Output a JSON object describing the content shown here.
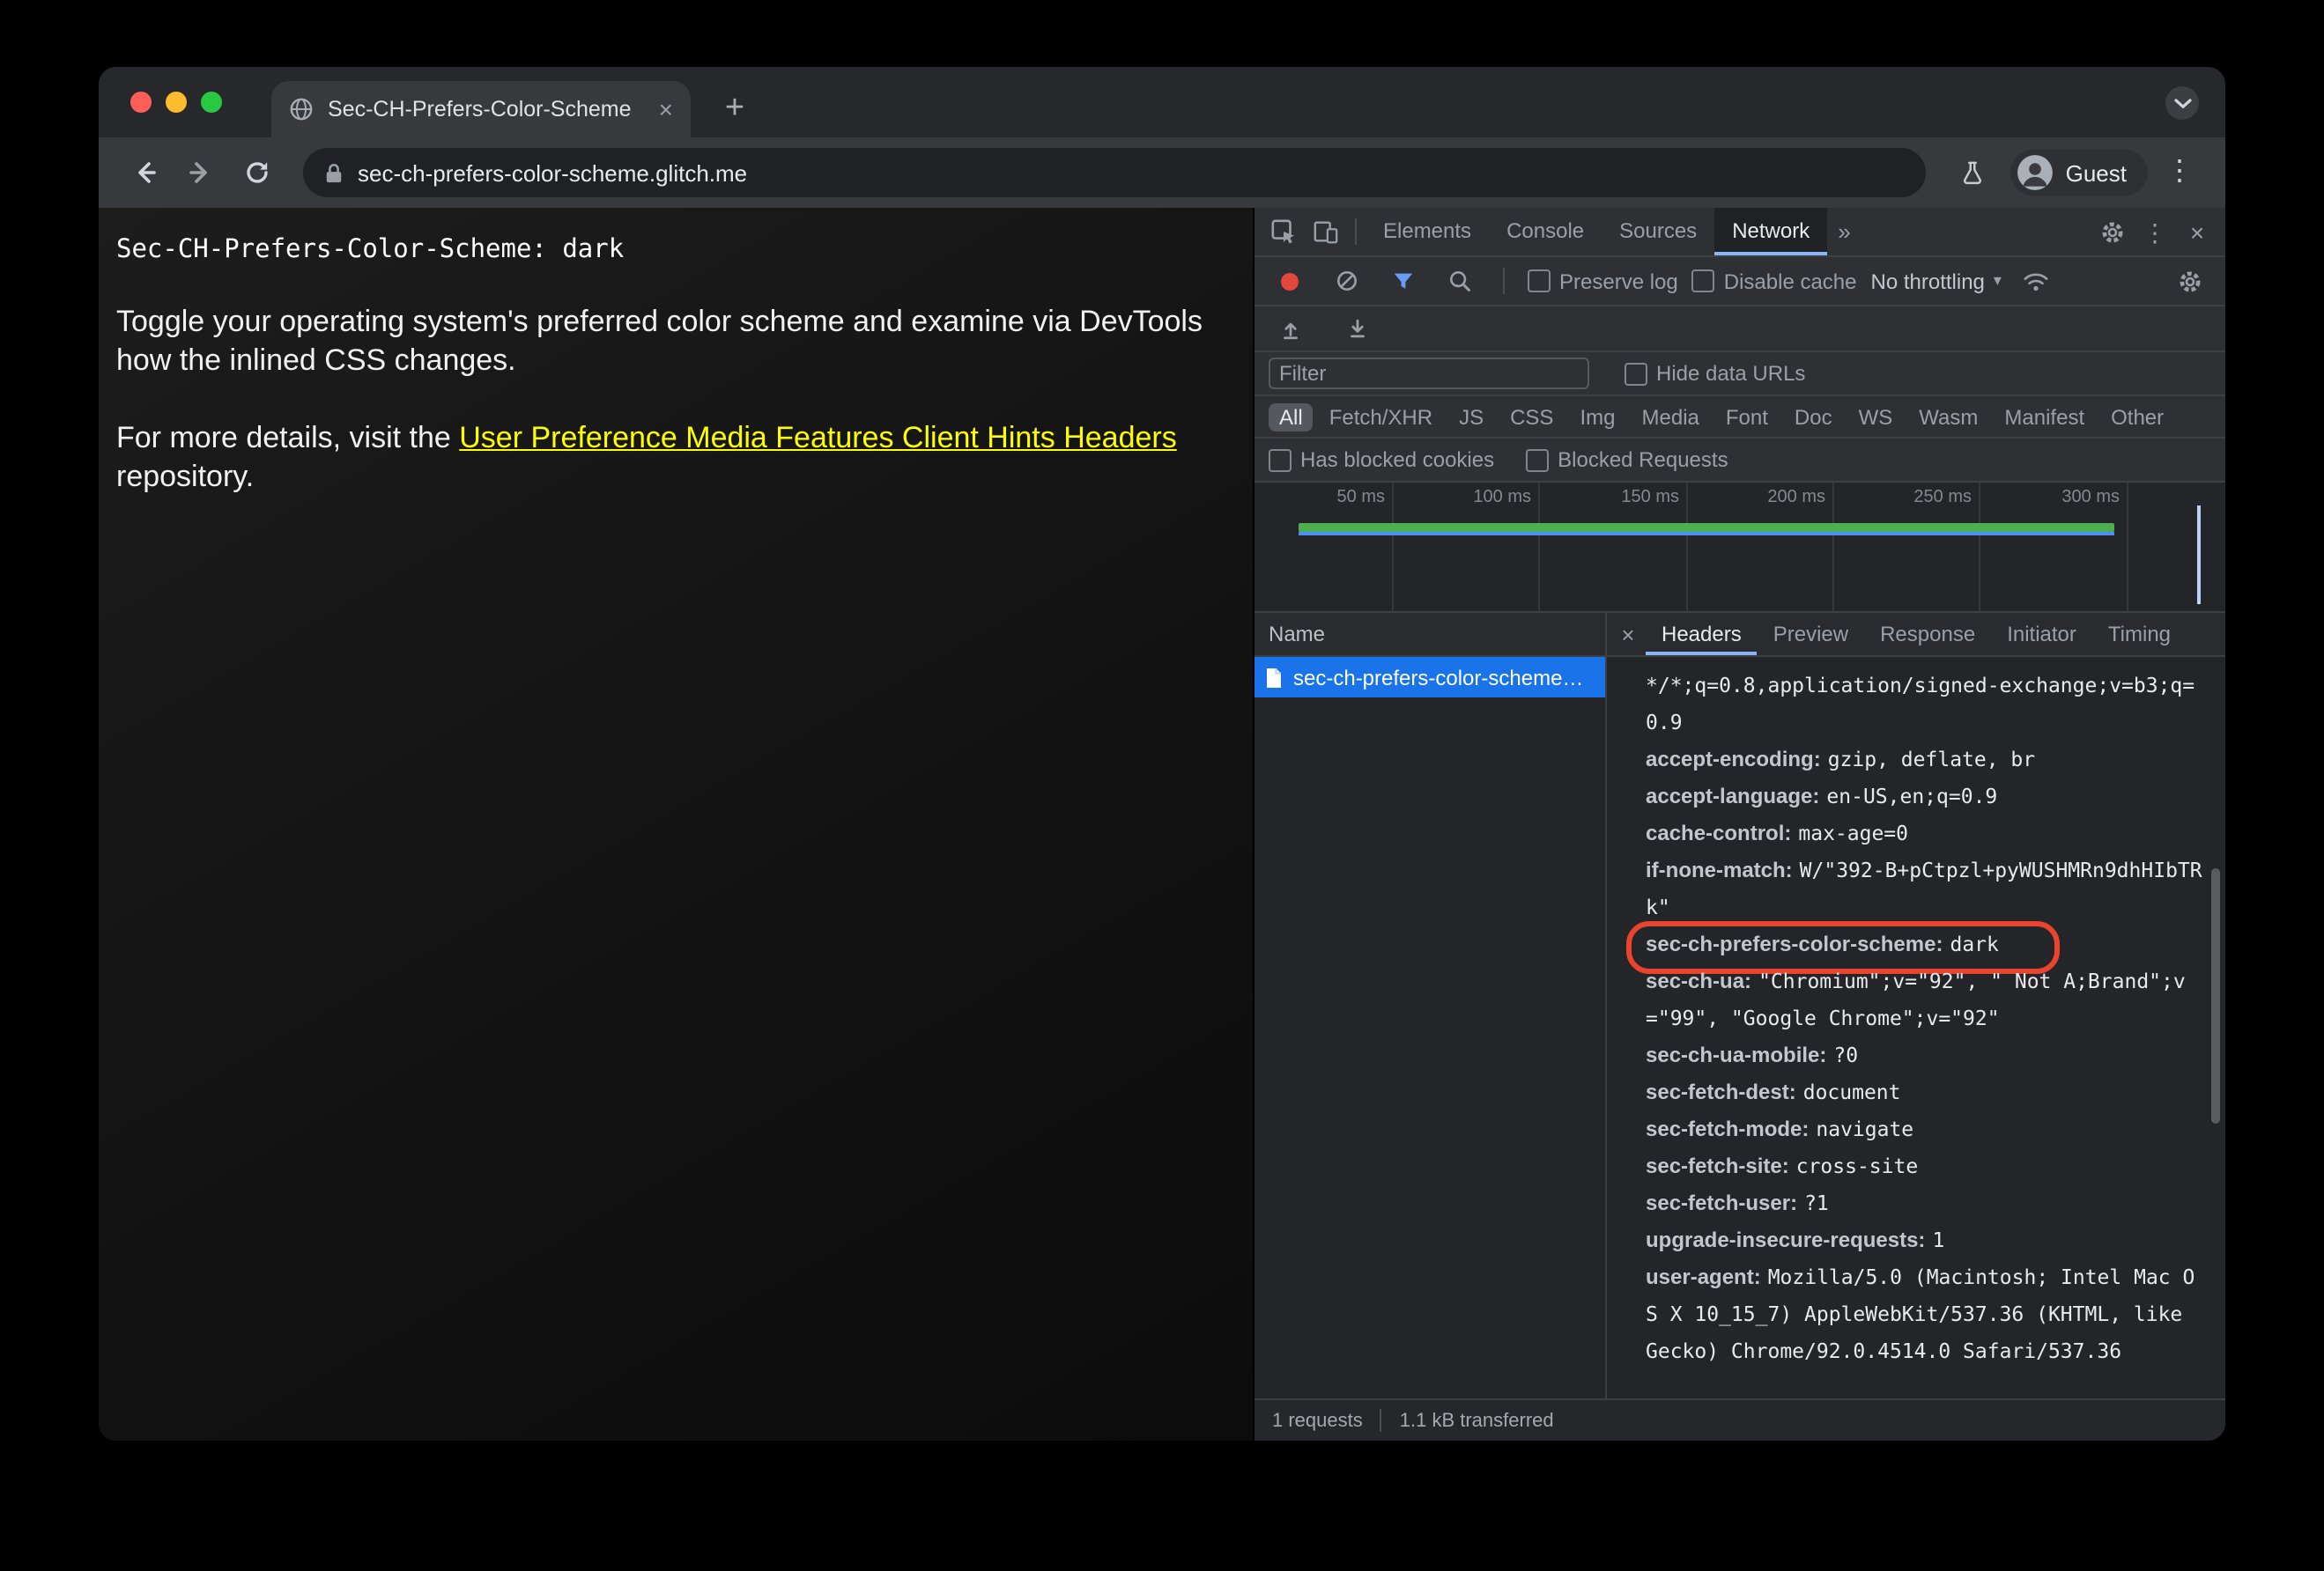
{
  "browser": {
    "tab_title": "Sec-CH-Prefers-Color-Scheme",
    "url": "sec-ch-prefers-color-scheme.glitch.me",
    "profile_label": "Guest"
  },
  "page": {
    "status_line": "Sec-CH-Prefers-Color-Scheme: dark",
    "paragraph1": "Toggle your operating system's preferred color scheme and examine via DevTools how the inlined CSS changes.",
    "paragraph2_before": "For more details, visit the ",
    "paragraph2_link": "User Preference Media Features Client Hints Headers",
    "paragraph2_after": " repository."
  },
  "devtools": {
    "panel_tabs": [
      "Elements",
      "Console",
      "Sources",
      "Network"
    ],
    "toolbar": {
      "preserve_log": "Preserve log",
      "disable_cache": "Disable cache",
      "throttling": "No throttling"
    },
    "filter_bar": {
      "placeholder": "Filter",
      "hide_data_urls": "Hide data URLs"
    },
    "type_chips": [
      "All",
      "Fetch/XHR",
      "JS",
      "CSS",
      "Img",
      "Media",
      "Font",
      "Doc",
      "WS",
      "Wasm",
      "Manifest",
      "Other"
    ],
    "blocked_options": [
      "Has blocked cookies",
      "Blocked Requests"
    ],
    "timeline_ticks": [
      "50 ms",
      "100 ms",
      "150 ms",
      "200 ms",
      "250 ms",
      "300 ms"
    ],
    "requests_table": {
      "name_header": "Name",
      "selected_request": "sec-ch-prefers-color-scheme…"
    },
    "detail_tabs": [
      "Headers",
      "Preview",
      "Response",
      "Initiator",
      "Timing"
    ],
    "headers": [
      {
        "name": "",
        "value": "*/*;q=0.8,application/signed-exchange;v=b3;q=0.9"
      },
      {
        "name": "accept-encoding:",
        "value": "gzip, deflate, br"
      },
      {
        "name": "accept-language:",
        "value": "en-US,en;q=0.9"
      },
      {
        "name": "cache-control:",
        "value": "max-age=0"
      },
      {
        "name": "if-none-match:",
        "value": "W/\"392-B+pCtpzl+pyWUSHMRn9dhHIbTRk\""
      },
      {
        "name": "sec-ch-prefers-color-scheme:",
        "value": "dark"
      },
      {
        "name": "sec-ch-ua:",
        "value": "\"Chromium\";v=\"92\", \" Not A;Brand\";v=\"99\", \"Google Chrome\";v=\"92\""
      },
      {
        "name": "sec-ch-ua-mobile:",
        "value": "?0"
      },
      {
        "name": "sec-fetch-dest:",
        "value": "document"
      },
      {
        "name": "sec-fetch-mode:",
        "value": "navigate"
      },
      {
        "name": "sec-fetch-site:",
        "value": "cross-site"
      },
      {
        "name": "sec-fetch-user:",
        "value": "?1"
      },
      {
        "name": "upgrade-insecure-requests:",
        "value": "1"
      },
      {
        "name": "user-agent:",
        "value": "Mozilla/5.0 (Macintosh; Intel Mac OS X 10_15_7) AppleWebKit/537.36 (KHTML, like Gecko) Chrome/92.0.4514.0 Safari/537.36"
      }
    ],
    "status_bar": {
      "requests": "1 requests",
      "transferred": "1.1 kB transferred"
    }
  },
  "glyphs": {
    "close": "×",
    "kebab": "⋮",
    "more_tabs": "»",
    "new_tab": "+",
    "caret": "▾"
  },
  "colors": {
    "accent_blue": "#1a73e8",
    "tab_underline_blue": "#8ab4f8",
    "filter_blue": "#669df6",
    "record_red": "#e0483e",
    "timeline_green": "#4caf50",
    "timeline_blue": "#4f8df5",
    "annotation_red": "#e8442e",
    "link_yellow": "#ffff00",
    "traffic_red": "#ff5f57",
    "traffic_yellow": "#febc2e",
    "traffic_green": "#28c840"
  }
}
